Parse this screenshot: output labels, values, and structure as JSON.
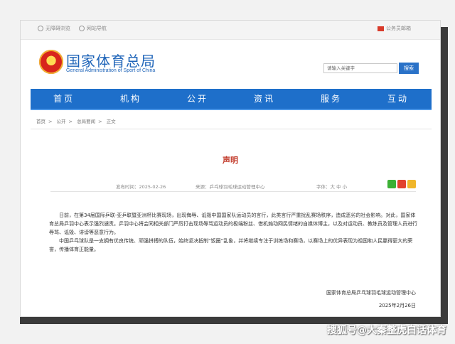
{
  "topbar": {
    "accessibility": "无障碍浏览",
    "mobile": "网站导航",
    "official": "公务员邮箱"
  },
  "header": {
    "title": "国家体育总局",
    "subtitle": "General Administration of Sport of China"
  },
  "search": {
    "placeholder": "请输入关键字",
    "button": "搜索"
  },
  "nav": [
    "首页",
    "机构",
    "公开",
    "资讯",
    "服务",
    "互动"
  ],
  "breadcrumb": [
    "首页",
    "公开",
    "总局要闻",
    "正文"
  ],
  "article": {
    "title": "声明",
    "date": "发布时间：2025-02-26",
    "source": "来源：乒乓球羽毛球运动管理中心",
    "fontsize": "字体：大 中 小",
    "paragraphs": [
      "日前，在第34届国际乒联-亚乒联暨亚洲杯比赛现场，出现侮辱、诋毁中国国家队运动员的言行，此类言行严重扰乱赛场秩序，造成恶劣的社会影响。对此，国家体育总局乒羽中心表示强烈谴责。乒羽中心将会同相关部门严厉打击现场辱骂运动员的极端粉丝、借机煽动网民情绪的自媒体博主，以及对运动员、教练员及管理人员进行辱骂、诋毁、诽谤等恶意行为。",
      "中国乒乓球队是一支拥有优良传统、顽强拼搏的队伍，始终坚决抵制“饭圈”乱象，并将继续专注于训练场和赛场，以赛场上的优异表现为祖国和人民赢得更大的荣誉，传播体育正能量。"
    ],
    "signature": "国家体育总局乒乓球羽毛球运动管理中心",
    "sign_date": "2025年2月26日"
  },
  "watermark": "搜狐号@大秦整虎白话体育",
  "colors": {
    "nav": "#1e6fca",
    "title": "#1d63b8",
    "doc_title": "#c23a2a"
  }
}
